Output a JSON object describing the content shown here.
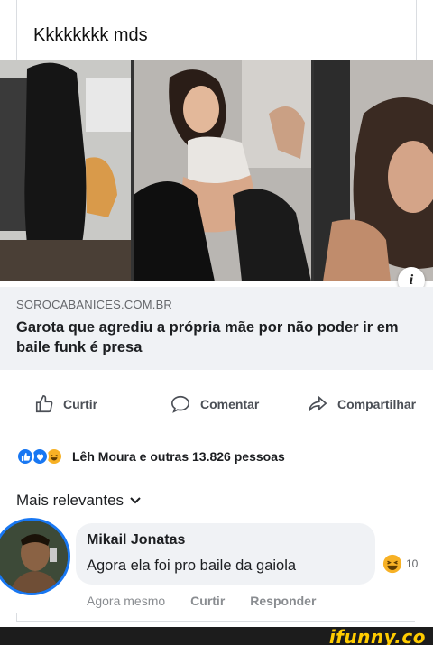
{
  "post": {
    "caption": "Kkkkkkkk mds"
  },
  "link_preview": {
    "domain": "SOROCABANICES.COM.BR",
    "title": "Garota que agrediu a própria mãe por não poder ir em baile funk é presa",
    "info_icon": "info-icon"
  },
  "actions": {
    "like": "Curtir",
    "comment": "Comentar",
    "share": "Compartilhar"
  },
  "reactions": {
    "icons": [
      "like-icon",
      "love-icon",
      "haha-icon"
    ],
    "summary": "Lêh Moura e outras 13.826 pessoas"
  },
  "comments_section": {
    "sort_label": "Mais relevantes"
  },
  "comment": {
    "author": "Mikail Jonatas",
    "text": "Agora ela foi pro baile da gaiola",
    "reaction_count": "10",
    "time": "Agora mesmo",
    "like": "Curtir",
    "reply": "Responder"
  },
  "watermark": {
    "text": "ifunny.co"
  },
  "colors": {
    "accent": "#1877f2",
    "watermark": "#ffcc00"
  }
}
